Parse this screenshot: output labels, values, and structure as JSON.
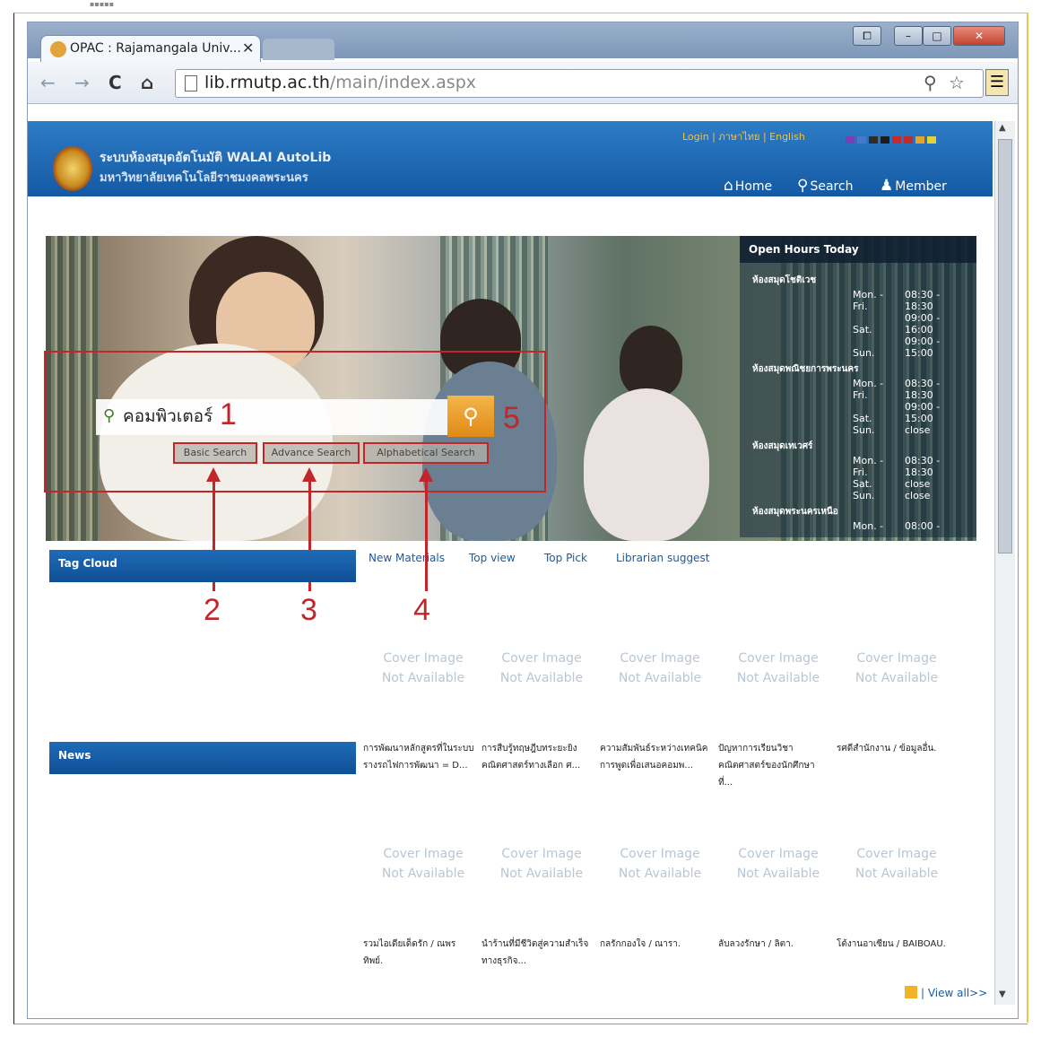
{
  "browser": {
    "tab_title": "OPAC : Rajamangala Univ...",
    "tab_close": "✕",
    "url_host": "lib.rmutp.ac.th",
    "url_path": "/main/index.aspx",
    "window_buttons": [
      "⧠",
      "–",
      "□",
      "✕"
    ],
    "nav": {
      "back": "←",
      "forward": "→",
      "reload": "C",
      "home": "⌂"
    }
  },
  "header": {
    "top_links": "Login | ภาษาไทย | English",
    "swatch_colors": [
      "#7b3fb4",
      "#4a78c8",
      "#2d2d2d",
      "#1b1b1b",
      "#c32b2b",
      "#c32b2b",
      "#e6a32a",
      "#e0d23a"
    ],
    "title": "ระบบห้องสมุดอัตโนมัติ WALAI AutoLib",
    "subtitle": "มหาวิทยาลัยเทคโนโลยีราชมงคลพระนคร",
    "nav": [
      {
        "icon": "home-icon",
        "glyph": "⌂",
        "label": "Home"
      },
      {
        "icon": "search-icon",
        "glyph": "⚲",
        "label": "Search"
      },
      {
        "icon": "member-icon",
        "glyph": "👤",
        "label": "Member"
      }
    ]
  },
  "hours": {
    "title": "Open Hours Today",
    "branches": [
      {
        "name": "ห้องสมุดโชติเวช",
        "rows": [
          {
            "day": "Mon. -",
            "time": "08:30 -"
          },
          {
            "day": "Fri.",
            "time": "18:30"
          },
          {
            "day": "",
            "time": "09:00 -"
          },
          {
            "day": "Sat.",
            "time": "16:00"
          },
          {
            "day": "",
            "time": "09:00 -"
          },
          {
            "day": "Sun.",
            "time": "15:00"
          }
        ]
      },
      {
        "name": "ห้องสมุดพณิชยการพระนคร",
        "rows": [
          {
            "day": "Mon. -",
            "time": "08:30 -"
          },
          {
            "day": "Fri.",
            "time": "18:30"
          },
          {
            "day": "",
            "time": "09:00 -"
          },
          {
            "day": "Sat.",
            "time": "15:00"
          },
          {
            "day": "Sun.",
            "time": "close"
          }
        ]
      },
      {
        "name": "ห้องสมุดเทเวศร์",
        "rows": [
          {
            "day": "Mon. -",
            "time": "08:30 -"
          },
          {
            "day": "Fri.",
            "time": "18:30"
          },
          {
            "day": "Sat.",
            "time": "close"
          },
          {
            "day": "Sun.",
            "time": "close"
          }
        ]
      },
      {
        "name": "ห้องสมุดพระนครเหนือ",
        "rows": [
          {
            "day": "Mon. -",
            "time": "08:00 -"
          }
        ]
      }
    ]
  },
  "search": {
    "query": "คอมพิวเตอร์",
    "button_glyph": "⚲",
    "modes": [
      "Basic Search",
      "Advance Search",
      "Alphabetical Search"
    ]
  },
  "annotations": [
    "1",
    "2",
    "3",
    "4",
    "5"
  ],
  "sidebar": {
    "tag_cloud": "Tag Cloud",
    "news": "News"
  },
  "content_tabs": [
    "New Materials",
    "Top view",
    "Top Pick",
    "Librarian suggest"
  ],
  "cover_placeholder": {
    "line1": "Cover Image",
    "line2": "Not Available"
  },
  "books_row1": [
    "การพัฒนาหลักสูตรที่ในระบบรางรถไฟการพัฒนา = D...",
    "การสืบรู้ทฤษฎีบทระยะยิงคณิตศาสตร์ทางเลือก ศ...",
    "ความสัมพันธ์ระหว่างเทคนิคการพูดเพื่อเสนอคอมพ...",
    "ปัญหาการเรียนวิชาคณิตศาสตร์ของนักศึกษา ที่...",
    "รศดีสำนักงาน / ข้อมูลอื่น."
  ],
  "books_row2": [
    "รวมไอเดียเด็ดรัก / ณพรทิพย์.",
    "นำร้านที่มีชีวิตสู่ความสำเร็จทางธุรกิจ...",
    "กลรักกองใจ / ณารา.",
    "ลับลวงรักษา / ลิตา.",
    "โต้งานอาเซียน / BAIBOAU."
  ],
  "view_all": "| View all>>"
}
